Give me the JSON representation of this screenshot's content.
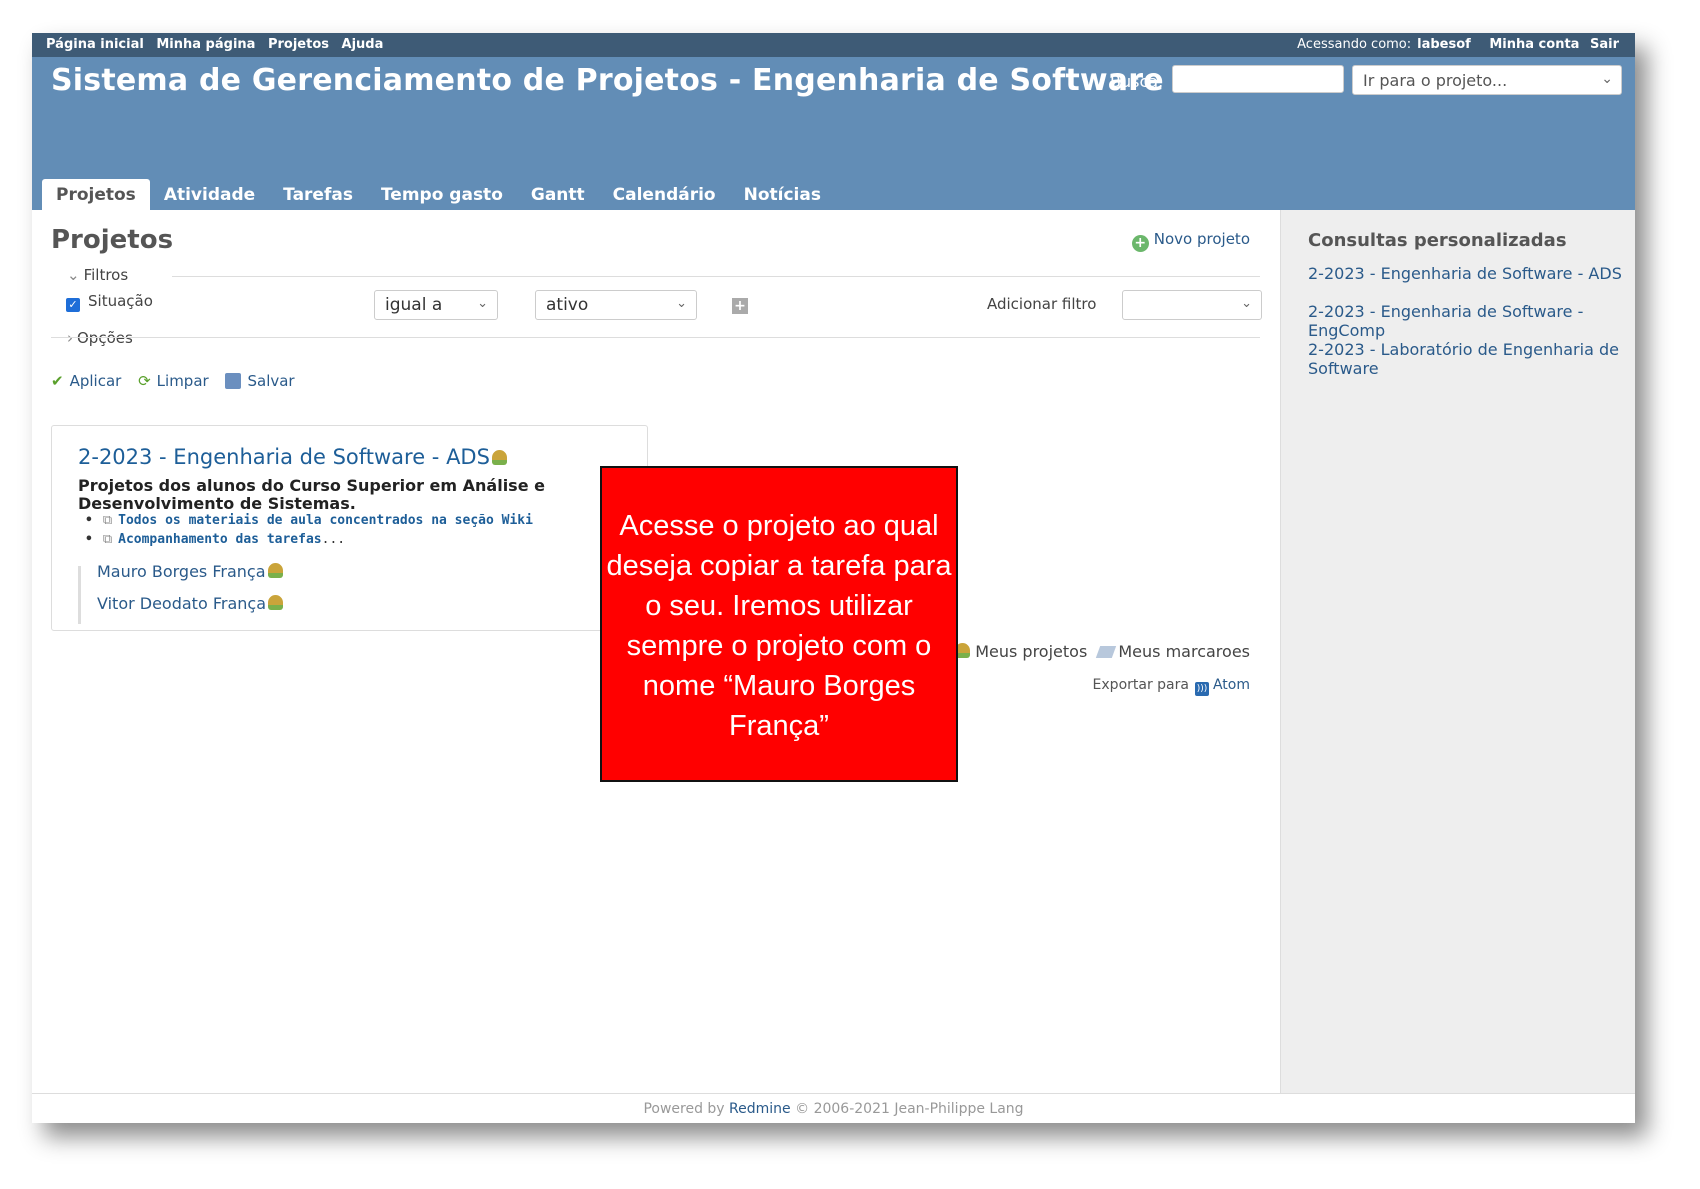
{
  "top_menu": {
    "items": [
      "Página inicial",
      "Minha página",
      "Projetos",
      "Ajuda"
    ],
    "logged_as_label": "Acessando como:",
    "user": "labesof",
    "account": "Minha conta",
    "logout": "Sair"
  },
  "header": {
    "title": "Sistema de Gerenciamento de Projetos - Engenharia de Software",
    "search_label": "Busca:",
    "project_jump_placeholder": "Ir para o projeto..."
  },
  "main_menu": {
    "tabs": [
      "Projetos",
      "Atividade",
      "Tarefas",
      "Tempo gasto",
      "Gantt",
      "Calendário",
      "Notícias"
    ]
  },
  "content": {
    "page_title": "Projetos",
    "new_project": "Novo projeto",
    "filters_legend": "Filtros",
    "status_label": "Situação",
    "operator": "igual a",
    "value": "ativo",
    "add_filter_label": "Adicionar filtro",
    "options_legend": "Opções",
    "actions": {
      "apply": "Aplicar",
      "clear": "Limpar",
      "save": "Salvar"
    },
    "project": {
      "name": "2-2023 - Engenharia de Software - ADS",
      "description": "Projetos dos alunos do Curso Superior em Análise e Desenvolvimento de Sistemas.",
      "wiki_links": [
        "Todos os materiais de aula concentrados na seção Wiki",
        "Acompanhamento das tarefas"
      ],
      "wiki_suffix": "...",
      "subprojects": [
        "Mauro Borges França",
        "Vitor Deodato França"
      ]
    },
    "my_projects": "Meus projetos",
    "my_bookmarks": "Meus marcaroes",
    "export_label": "Exportar para",
    "export_atom": "Atom"
  },
  "sidebar": {
    "title": "Consultas personalizadas",
    "queries": [
      "2-2023 - Engenharia de Software - ADS",
      "2-2023 - Engenharia de Software - EngComp",
      "2-2023 - Laboratório de Engenharia de Software"
    ]
  },
  "footer": {
    "prefix": "Powered by",
    "link": "Redmine",
    "suffix": "© 2006-2021 Jean-Philippe Lang"
  },
  "callout": {
    "text": "Acesse o projeto ao qual deseja copiar a tarefa para o seu. Iremos utilizar sempre o projeto com o nome “Mauro Borges França”"
  },
  "colors": {
    "top_bar": "#3e5b76",
    "header": "#628db6",
    "link": "#2a5a8a",
    "callout": "#ff0000"
  }
}
